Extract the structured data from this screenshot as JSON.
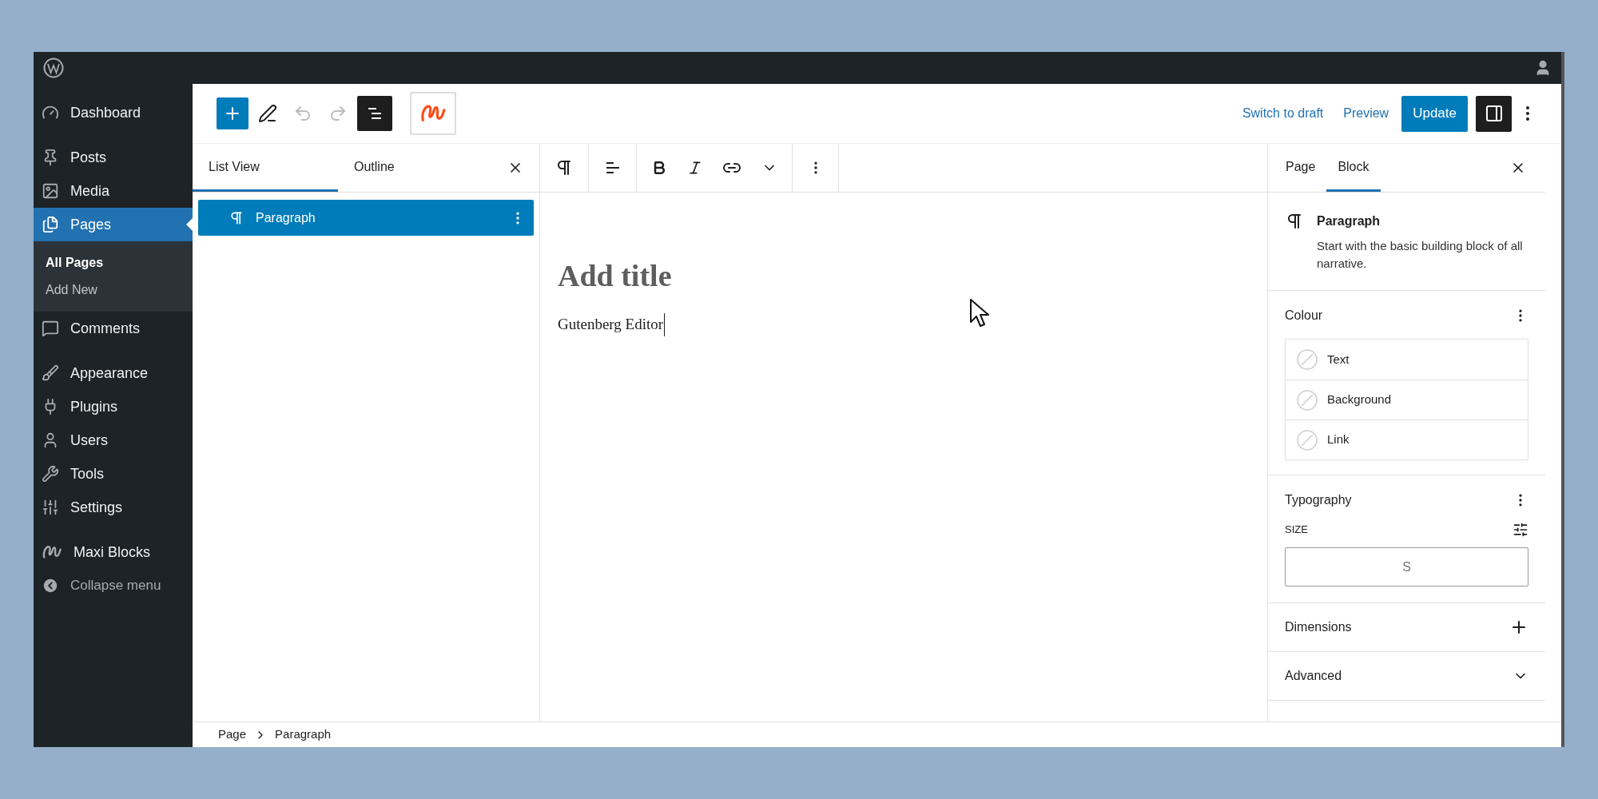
{
  "sidebar": {
    "groups": [
      [
        {
          "label": "Dashboard",
          "selected": false
        }
      ],
      [
        {
          "label": "Posts",
          "selected": false
        },
        {
          "label": "Media",
          "selected": false
        },
        {
          "label": "Pages",
          "selected": true,
          "children": [
            {
              "label": "All Pages",
              "selected": true
            },
            {
              "label": "Add New",
              "selected": false
            }
          ]
        },
        {
          "label": "Comments",
          "selected": false
        }
      ],
      [
        {
          "label": "Appearance",
          "selected": false
        },
        {
          "label": "Plugins",
          "selected": false
        },
        {
          "label": "Users",
          "selected": false
        },
        {
          "label": "Tools",
          "selected": false
        },
        {
          "label": "Settings",
          "selected": false
        }
      ],
      [
        {
          "label": "Maxi Blocks",
          "selected": false
        }
      ]
    ],
    "collapse": {
      "label": "Collapse menu"
    }
  },
  "header": {
    "undo_disabled": true,
    "redo_disabled": true,
    "list_view_pressed": true,
    "switch_to_draft": "Switch to draft",
    "preview": "Preview",
    "primary_button": "Update",
    "settings_pressed": true
  },
  "list_panel": {
    "tabs": [
      {
        "label": "List View",
        "selected": true
      },
      {
        "label": "Outline",
        "selected": false
      }
    ],
    "tree": [
      {
        "label": "Paragraph",
        "selected": true
      }
    ]
  },
  "canvas": {
    "title": {
      "placeholder": "Add title"
    },
    "paragraph": "Gutenberg Editor"
  },
  "settings_panel": {
    "tabs": [
      {
        "label": "Page",
        "selected": false
      },
      {
        "label": "Block",
        "selected": true
      }
    ],
    "block_card": {
      "title": "Paragraph",
      "description": "Start with the basic building block of all narrative."
    },
    "panels": [
      {
        "kind": "colour",
        "title": "Colour",
        "items": [
          "Text",
          "Background",
          "Link"
        ]
      },
      {
        "kind": "typography",
        "title": "Typography",
        "size_label": "SIZE",
        "size_value": "S"
      },
      {
        "kind": "plus",
        "title": "Dimensions"
      },
      {
        "kind": "chevron",
        "title": "Advanced"
      }
    ]
  },
  "breadcrumb": [
    "Page",
    "Paragraph"
  ]
}
